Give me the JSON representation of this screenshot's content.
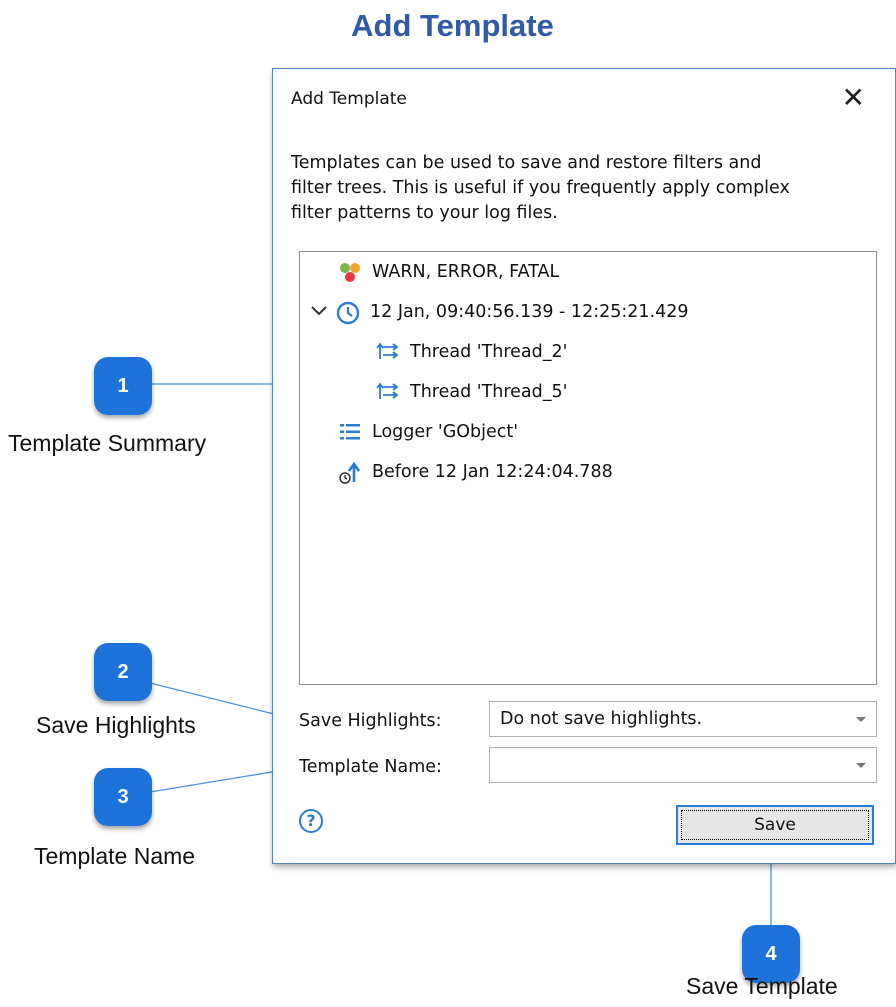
{
  "page": {
    "title": "Add Template"
  },
  "dialog": {
    "title": "Add Template",
    "close_label": "✕",
    "description_lines": [
      "Templates can be used to save and restore filters and",
      "filter trees.  This is useful if you frequently apply complex",
      "filter patterns to your log files."
    ],
    "tree": [
      {
        "label": "WARN, ERROR, FATAL",
        "icon": "levels-icon"
      },
      {
        "label": "12 Jan, 09:40:56.139 - 12:25:21.429",
        "icon": "clock-icon",
        "expanded": true
      },
      {
        "label": "Thread 'Thread_2'",
        "icon": "thread-icon"
      },
      {
        "label": "Thread 'Thread_5'",
        "icon": "thread-icon"
      },
      {
        "label": "Logger 'GObject'",
        "icon": "logger-icon"
      },
      {
        "label": "Before 12 Jan 12:24:04.788",
        "icon": "before-time-icon"
      }
    ],
    "save_highlights": {
      "label": "Save Highlights:",
      "value": "Do not save highlights."
    },
    "template_name": {
      "label": "Template Name:",
      "value": ""
    },
    "help_label": "?",
    "save_button": "Save"
  },
  "callouts": [
    {
      "number": "1",
      "label": "Template Summary"
    },
    {
      "number": "2",
      "label": "Save Highlights"
    },
    {
      "number": "3",
      "label": "Template Name"
    },
    {
      "number": "4",
      "label": "Save Template"
    }
  ],
  "colors": {
    "title": "#2f5aa8",
    "badge": "#1d73d9",
    "accent": "#2a7bd4"
  }
}
